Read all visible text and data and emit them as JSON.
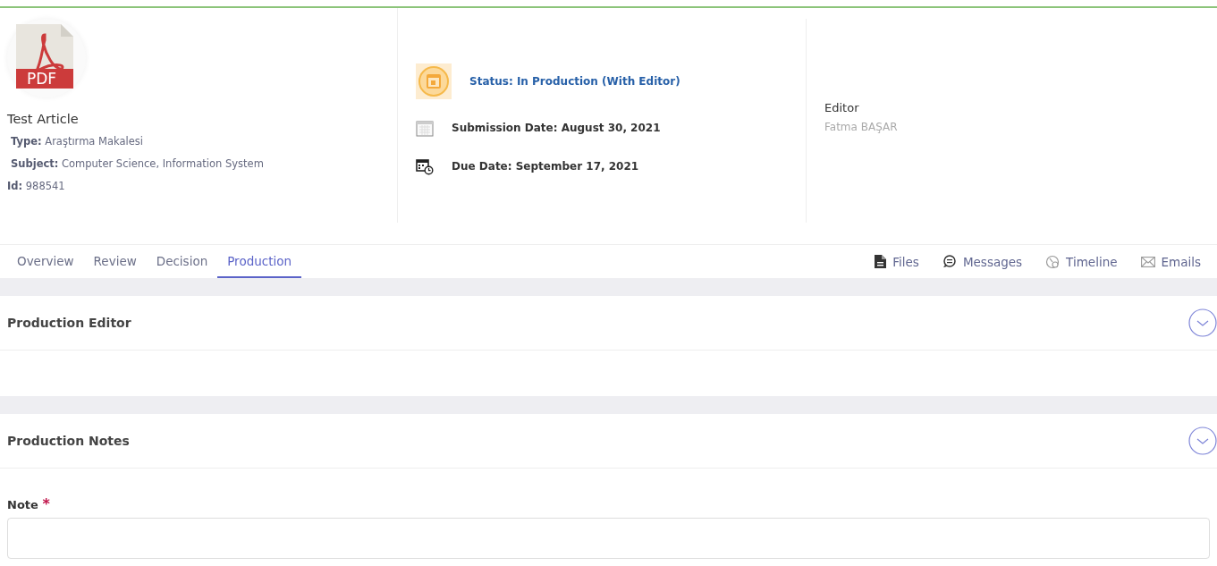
{
  "article": {
    "file_badge": "PDF",
    "title": "Test Article",
    "meta": [
      {
        "label": "Type:",
        "value": "Araştırma Makalesi"
      },
      {
        "label": "Subject:",
        "value": "Computer Science, Information System"
      },
      {
        "label": "Id:",
        "value": "988541"
      }
    ]
  },
  "status": {
    "text": "Status: In Production (With Editor)",
    "dates": [
      {
        "kind": "submission",
        "text": "Submission Date: August 30, 2021"
      },
      {
        "kind": "due",
        "text": "Due Date: September 17, 2021"
      }
    ]
  },
  "editor": {
    "heading": "Editor",
    "name": "Fatma BAŞAR"
  },
  "tabs": [
    {
      "label": "Overview",
      "selected": false
    },
    {
      "label": "Review",
      "selected": false
    },
    {
      "label": "Decision",
      "selected": false
    },
    {
      "label": "Production",
      "selected": true
    }
  ],
  "links": [
    {
      "kind": "files",
      "label": "Files"
    },
    {
      "kind": "messages",
      "label": "Messages"
    },
    {
      "kind": "timeline",
      "label": "Timeline"
    },
    {
      "kind": "emails",
      "label": "Emails"
    }
  ],
  "panels": [
    {
      "title": "Production Editor"
    },
    {
      "title": "Production Notes"
    }
  ],
  "note": {
    "label": "Note",
    "required_mark": "*"
  }
}
